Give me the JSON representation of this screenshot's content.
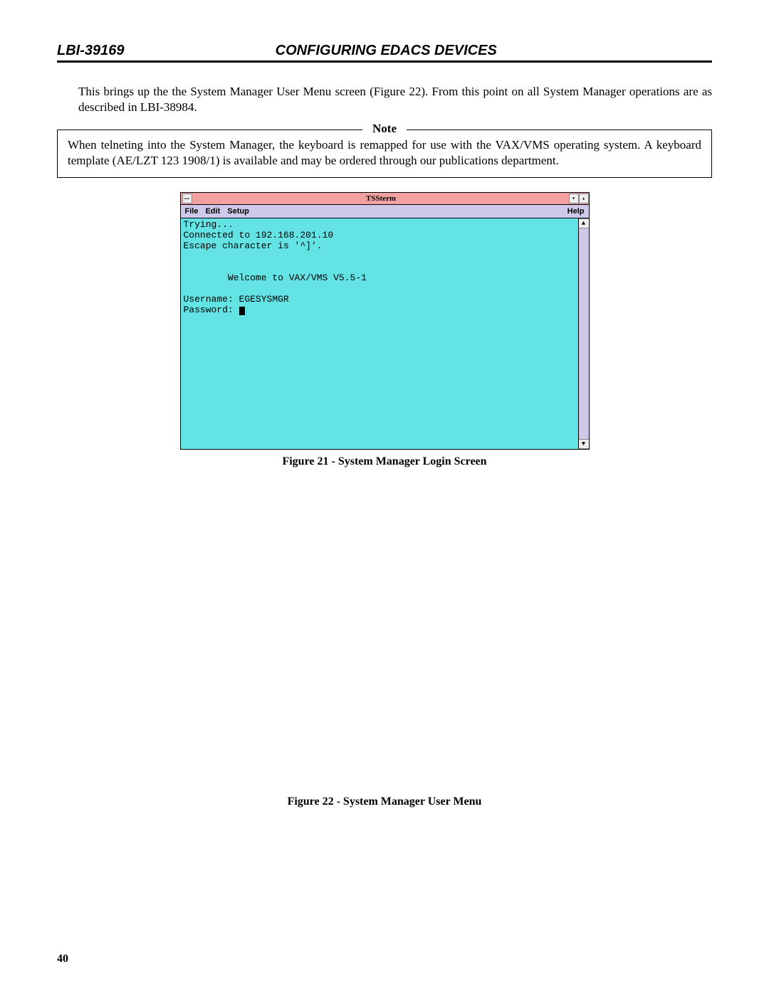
{
  "header": {
    "doc_id": "LBI-39169",
    "title": "CONFIGURING EDACS DEVICES"
  },
  "intro": "This brings up the the System Manager User Menu screen (Figure 22).  From this point on all System Manager operations are as described in LBI-38984.",
  "note": {
    "label": "Note",
    "text": "When telneting into the System Manager, the keyboard is remapped for use with the VAX/VMS operating system. A keyboard template (AE/LZT 123 1908/1) is available and may be ordered through our publications department."
  },
  "terminal": {
    "titlebar": {
      "sysmenu_glyph": "—",
      "title": "TSSterm",
      "btn1": "▾",
      "btn2": "▴"
    },
    "menubar": {
      "items": [
        "File",
        "Edit",
        "Setup"
      ],
      "help": "Help"
    },
    "lines": {
      "l1": "Trying...",
      "l2": "Connected to 192.168.201.10",
      "l3": "Escape character is '^]'.",
      "blank": "",
      "welcome": "        Welcome to VAX/VMS V5.5-1",
      "user": "Username: EGESYSMGR",
      "pass": "Password: "
    },
    "scroll": {
      "up": "▲",
      "down": "▼"
    }
  },
  "captions": {
    "fig21": "Figure 21 - System Manager Login Screen",
    "fig22": "Figure 22 - System Manager User Menu"
  },
  "page_number": "40"
}
